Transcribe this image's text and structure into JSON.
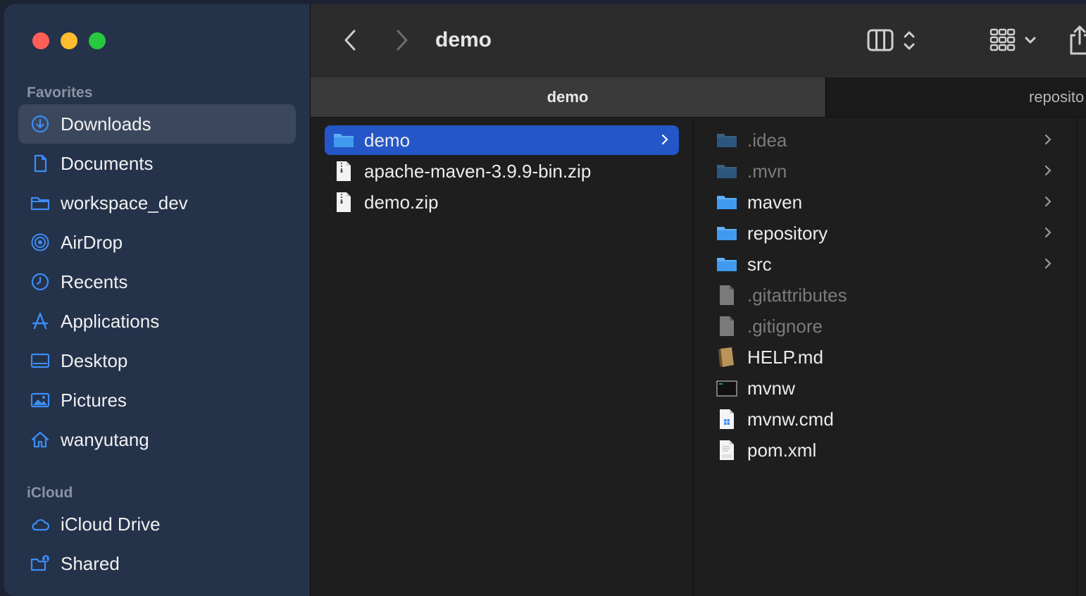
{
  "sidebar": {
    "favorites_title": "Favorites",
    "icloud_title": "iCloud",
    "favorites": [
      {
        "label": "Downloads",
        "icon": "downloads-icon",
        "selected": true
      },
      {
        "label": "Documents",
        "icon": "document-icon"
      },
      {
        "label": "workspace_dev",
        "icon": "folder-icon"
      },
      {
        "label": "AirDrop",
        "icon": "airdrop-icon"
      },
      {
        "label": "Recents",
        "icon": "clock-icon"
      },
      {
        "label": "Applications",
        "icon": "applications-icon"
      },
      {
        "label": "Desktop",
        "icon": "desktop-icon"
      },
      {
        "label": "Pictures",
        "icon": "pictures-icon"
      },
      {
        "label": "wanyutang",
        "icon": "home-icon"
      }
    ],
    "icloud": [
      {
        "label": "iCloud Drive",
        "icon": "cloud-icon"
      },
      {
        "label": "Shared",
        "icon": "shared-folder-icon"
      }
    ]
  },
  "toolbar": {
    "title": "demo"
  },
  "tabs": [
    {
      "label": "demo",
      "active": true
    },
    {
      "label": "reposito",
      "active": false
    }
  ],
  "column1": [
    {
      "name": "demo",
      "type": "folder",
      "selected": true,
      "has_children": true
    },
    {
      "name": "apache-maven-3.9.9-bin.zip",
      "type": "zip"
    },
    {
      "name": "demo.zip",
      "type": "zip"
    }
  ],
  "column2": [
    {
      "name": ".idea",
      "type": "folder",
      "dim": true,
      "has_children": true
    },
    {
      "name": ".mvn",
      "type": "folder",
      "dim": true,
      "has_children": true
    },
    {
      "name": "maven",
      "type": "folder",
      "has_children": true
    },
    {
      "name": "repository",
      "type": "folder",
      "has_children": true
    },
    {
      "name": "src",
      "type": "folder",
      "has_children": true
    },
    {
      "name": ".gitattributes",
      "type": "file",
      "dim": true
    },
    {
      "name": ".gitignore",
      "type": "file",
      "dim": true
    },
    {
      "name": "HELP.md",
      "type": "md"
    },
    {
      "name": "mvnw",
      "type": "exec"
    },
    {
      "name": "mvnw.cmd",
      "type": "cmd"
    },
    {
      "name": "pom.xml",
      "type": "xml"
    }
  ],
  "colors": {
    "accent": "#2456c8",
    "icon_blue": "#3d8df5",
    "sidebar": "#24324a"
  }
}
